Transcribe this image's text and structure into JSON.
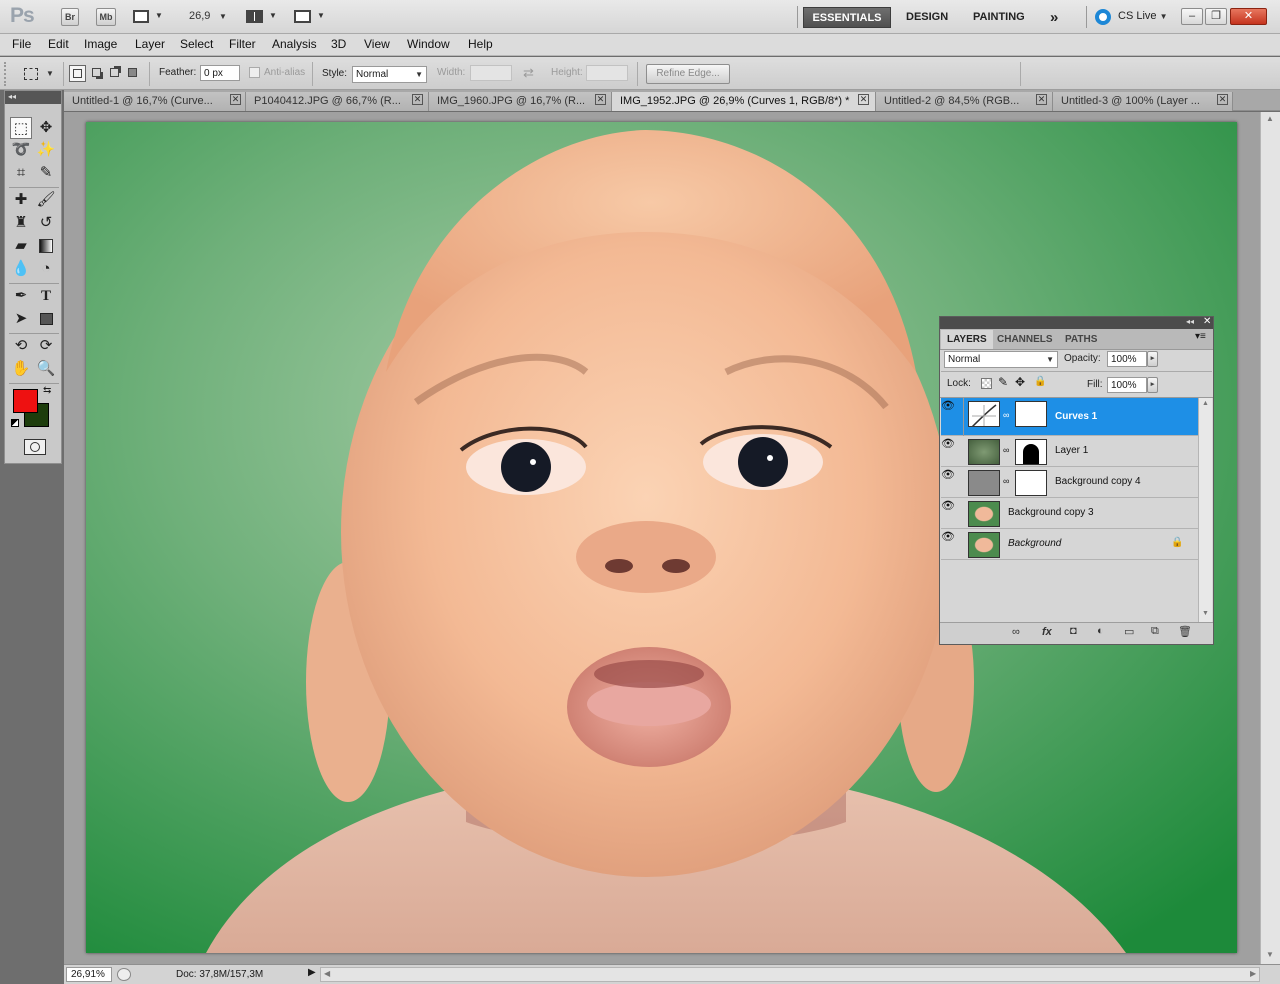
{
  "app": {
    "logo": "Ps",
    "bridge_btn": "Br",
    "minibridge_btn": "Mb",
    "zoom_value": "26,9",
    "workspaces": [
      "ESSENTIALS",
      "DESIGN",
      "PAINTING"
    ],
    "more_workspaces": "»",
    "cs_live": "CS Live"
  },
  "menu": [
    "File",
    "Edit",
    "Image",
    "Layer",
    "Select",
    "Filter",
    "Analysis",
    "3D",
    "View",
    "Window",
    "Help"
  ],
  "options": {
    "feather_label": "Feather:",
    "feather_value": "0 px",
    "antialias_label": "Anti-alias",
    "style_label": "Style:",
    "style_value": "Normal",
    "width_label": "Width:",
    "height_label": "Height:",
    "refine_edge": "Refine Edge..."
  },
  "tabs": [
    "Untitled-1 @ 16,7% (Curve...",
    "P1040412.JPG @ 66,7% (R...",
    "IMG_1960.JPG @ 16,7% (R...",
    "IMG_1952.JPG @ 26,9% (Curves 1, RGB/8*) *",
    "Untitled-2 @ 84,5% (RGB...",
    "Untitled-3 @ 100% (Layer ..."
  ],
  "active_tab_index": 3,
  "colors": {
    "foreground": "#ee1111",
    "background": "#1d3d0c",
    "selection_blue": "#1e8fe6"
  },
  "layers_panel": {
    "tabs": [
      "LAYERS",
      "CHANNELS",
      "PATHS"
    ],
    "blend_mode": "Normal",
    "opacity_label": "Opacity:",
    "opacity_value": "100%",
    "lock_label": "Lock:",
    "fill_label": "Fill:",
    "fill_value": "100%",
    "layers": [
      {
        "name": "Curves 1",
        "selected": true
      },
      {
        "name": "Layer 1",
        "selected": false
      },
      {
        "name": "Background copy 4",
        "selected": false
      },
      {
        "name": "Background copy 3",
        "selected": false
      },
      {
        "name": "Background",
        "selected": false
      }
    ]
  },
  "status": {
    "zoom": "26,91%",
    "doc": "Doc: 37,8M/157,3M"
  }
}
